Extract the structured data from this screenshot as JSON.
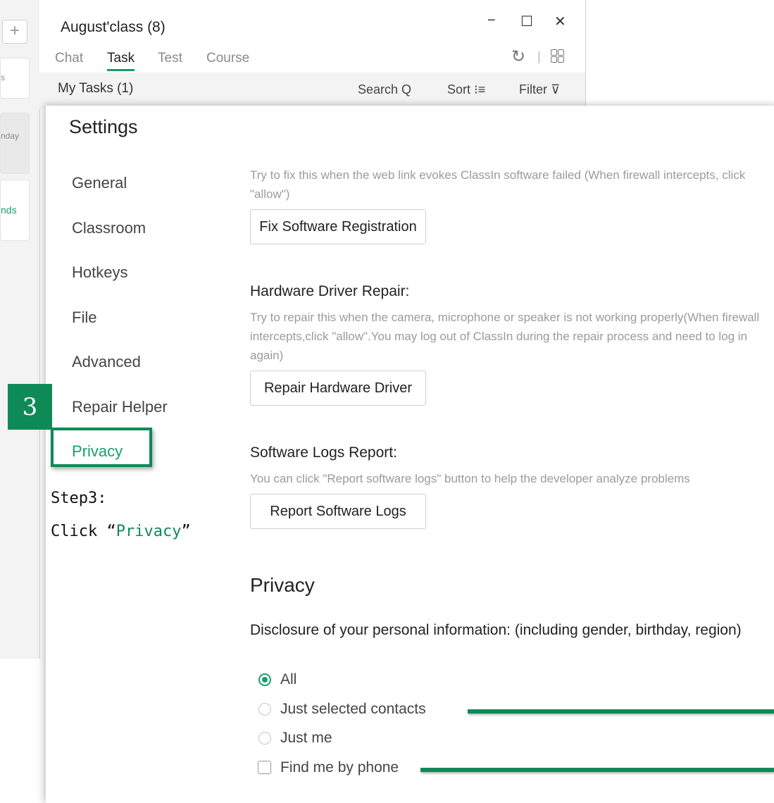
{
  "background": {
    "left_strip": {
      "plus_label": "+",
      "card1_text": "s",
      "card2_text": "nday",
      "card3_text": "nds"
    },
    "class_window": {
      "title": "August'class (8)",
      "controls": {
        "minimize": "−",
        "maximize": "☐",
        "close": "✕"
      },
      "tabs": [
        "Chat",
        "Task",
        "Test",
        "Course"
      ],
      "active_tab": "Task",
      "refresh_icon": "↻",
      "separator": "|",
      "subbar": {
        "title": "My Tasks  (1)",
        "search": "Search Q",
        "sort": "Sort ⁝≡",
        "filter": "Filter ⊽"
      }
    }
  },
  "settings": {
    "title": "Settings",
    "nav": [
      "General",
      "Classroom",
      "Hotkeys",
      "File",
      "Advanced",
      "Repair Helper",
      "Privacy"
    ],
    "active_nav": "Privacy",
    "registration": {
      "description": "Try to fix this when the web link evokes ClassIn software failed (When firewall intercepts, click \"allow\")",
      "button": "Fix Software Registration"
    },
    "hardware": {
      "title": "Hardware Driver Repair:",
      "description": "Try to repair this when the camera, microphone or speaker is not working properly(When firewall intercepts,click \"allow\".You may log out of ClassIn during the repair process and need to log in again)",
      "button": "Repair Hardware Driver"
    },
    "logs": {
      "title": "Software Logs Report:",
      "description": "You can click \"Report software logs\" button to help the developer analyze problems",
      "button": "Report Software Logs"
    },
    "privacy": {
      "heading": "Privacy",
      "disclosure": "Disclosure of your personal information: (including gender, birthday, region)",
      "options": [
        "All",
        "Just selected contacts",
        "Just me"
      ],
      "selected_option": "All",
      "find_by_phone": "Find me by phone",
      "find_by_phone_checked": false
    }
  },
  "tutorial": {
    "step_number": "3",
    "step_label": "Step3:",
    "instruction_prefix": "Click “",
    "instruction_target": "Privacy",
    "instruction_suffix": "”",
    "accent_color": "#0e8a57"
  }
}
